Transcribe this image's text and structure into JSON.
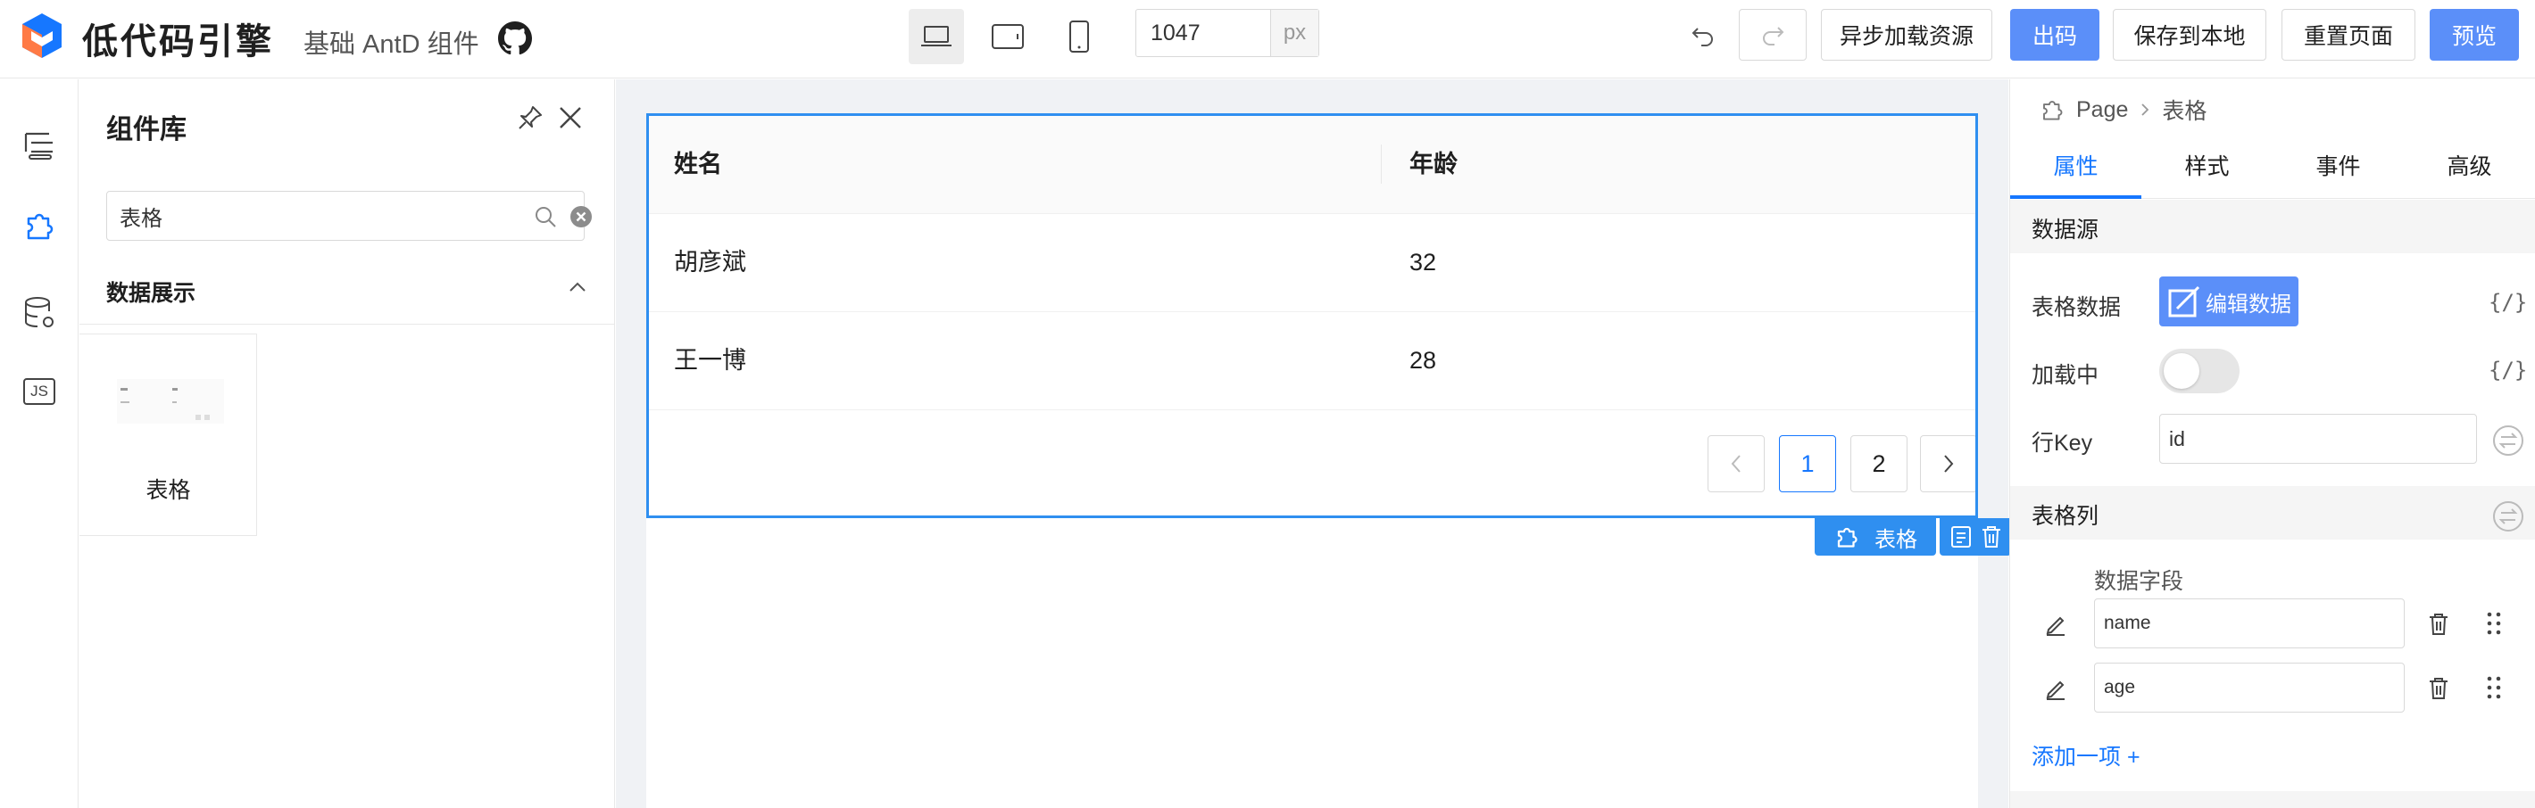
{
  "header": {
    "app_title": "低代码引擎",
    "subtitle": "基础 AntD 组件",
    "canvas_width": "1047",
    "unit": "px",
    "buttons": {
      "async_load": "异步加载资源",
      "code": "出码",
      "save_local": "保存到本地",
      "reset": "重置页面",
      "preview": "预览"
    },
    "colors": {
      "primary": "#5b8ff9",
      "selection": "#2f8ff0"
    }
  },
  "left_bar": {
    "icons": [
      "outline-tree-icon",
      "component-puzzle-icon",
      "datasource-db-icon",
      "js-code-icon"
    ],
    "js_label": "JS"
  },
  "component_panel": {
    "title": "组件库",
    "search_value": "表格",
    "category": "数据展示",
    "components": [
      {
        "label": "表格"
      }
    ]
  },
  "canvas": {
    "table": {
      "columns": [
        "姓名",
        "年龄"
      ],
      "rows": [
        [
          "胡彦斌",
          "32"
        ],
        [
          "王一博",
          "28"
        ]
      ],
      "pagination": {
        "current": "1",
        "pages": [
          "1",
          "2"
        ]
      }
    },
    "selection_label": "表格"
  },
  "settings": {
    "breadcrumb": [
      "Page",
      "表格"
    ],
    "tabs": [
      "属性",
      "样式",
      "事件",
      "高级"
    ],
    "active_tab": "属性",
    "sections": {
      "datasource": "数据源",
      "columns": "表格列"
    },
    "props": {
      "table_data_label": "表格数据",
      "edit_data_button": "编辑数据",
      "loading_label": "加载中",
      "loading_on": false,
      "rowkey_label": "行Key",
      "rowkey_value": "id",
      "expr_icon": "{/}"
    },
    "column_settings": {
      "field_header": "数据字段",
      "fields": [
        "name",
        "age"
      ],
      "add_item": "添加一项 +"
    }
  }
}
